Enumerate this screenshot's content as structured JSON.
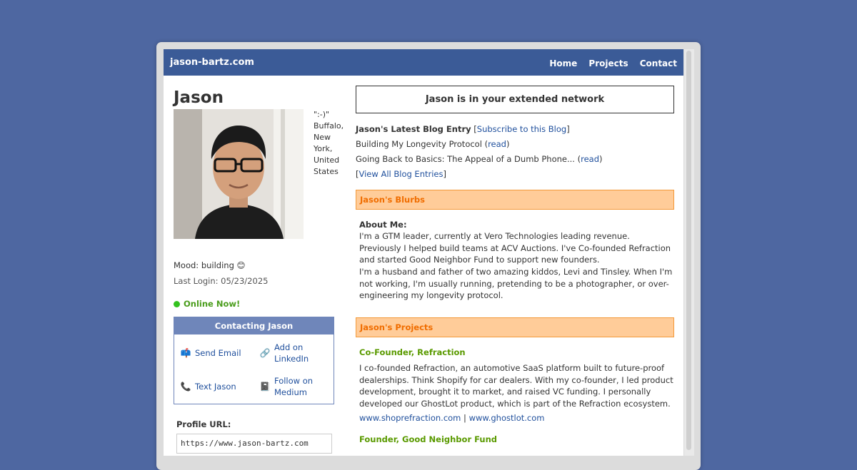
{
  "site": {
    "name": "jason-bartz.com",
    "nav": [
      "Home",
      "Projects",
      "Contact"
    ]
  },
  "profile": {
    "name": "Jason",
    "quote": "\":-)\"",
    "location": "Buffalo, New York, United States",
    "mood_label": "Mood: building 😊",
    "last_login": "Last Login: 05/23/2025",
    "online": "Online Now!"
  },
  "contact": {
    "title": "Contacting Jason",
    "items": [
      {
        "label": "Send Email",
        "icon": "mailbox-icon"
      },
      {
        "label": "Add on LinkedIn",
        "icon": "link-icon"
      },
      {
        "label": "Text Jason",
        "icon": "phone-icon"
      },
      {
        "label": "Follow on Medium",
        "icon": "book-icon"
      }
    ]
  },
  "profile_url": {
    "label": "Profile URL:",
    "value": "https://www.jason-bartz.com"
  },
  "network": "Jason is in your extended network",
  "blog": {
    "heading": "Jason's Latest Blog Entry",
    "subscribe": "Subscribe to this Blog",
    "entries": [
      {
        "title": "Building My Longevity Protocol",
        "link": "read"
      },
      {
        "title": "Going Back to Basics: The Appeal of a Dumb Phone...",
        "link": "read"
      }
    ],
    "view_all": "View All Blog Entries"
  },
  "blurbs": {
    "heading": "Jason's Blurbs",
    "about_label": "About Me:",
    "about_p1": "I'm a GTM leader, currently at Vero Technologies leading revenue. Previously I helped build teams at ACV Auctions. I've Co-founded Refraction and started Good Neighbor Fund to support new founders.",
    "about_p2": "I'm a husband and father of two amazing kiddos, Levi and Tinsley. When I'm not working, I'm usually running, pretending to be a photographer, or over-engineering my longevity protocol."
  },
  "projects": {
    "heading": "Jason's Projects",
    "items": [
      {
        "title": "Co-Founder, Refraction",
        "desc": "I co-founded Refraction, an automotive SaaS platform built to future-proof dealerships. Think Shopify for car dealers. With my co-founder, I led product development, brought it to market, and raised VC funding. I personally developed our GhostLot product, which is part of the Refraction ecosystem.",
        "link1": "www.shoprefraction.com",
        "sep": "|",
        "link2": "www.ghostlot.com"
      },
      {
        "title": "Founder, Good Neighbor Fund"
      }
    ]
  },
  "colors": {
    "background": "#4e67a1",
    "topbar": "#3b5b97",
    "section_head": "#ffcc99",
    "section_text": "#f06d00",
    "project_title": "#5a9a00",
    "link": "#1f4f9c"
  }
}
